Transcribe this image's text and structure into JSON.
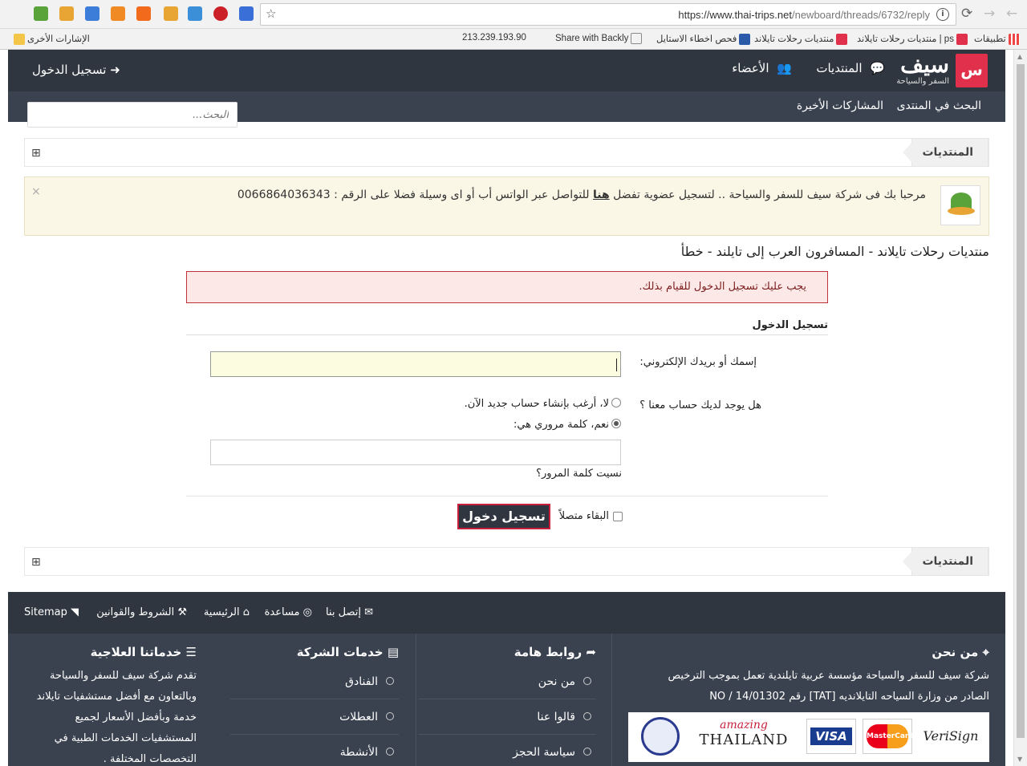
{
  "browser": {
    "url_host": "https://www.thai-trips.net",
    "url_path": "/newboard/threads/6732/reply",
    "bookmarks": [
      {
        "label": "تطبيقات"
      },
      {
        "label": "منتديات رحلات تايلاند | ps"
      },
      {
        "label": "منتديات رحلات تايلاند"
      },
      {
        "label": "فحص اخطاء الاستايل"
      },
      {
        "label": "Share with Backly"
      },
      {
        "label": "213.239.193.90"
      }
    ],
    "other_bookmarks": "الإشارات الأخرى"
  },
  "header": {
    "logo_mark": "سيف",
    "logo_sub": "السفر والسياحة",
    "nav_forums": "المنتديات",
    "nav_members": "الأعضاء",
    "login": "تسجيل الدخول"
  },
  "subnav": {
    "search_forum": "البحث في المنتدى",
    "recent_posts": "المشاركات الأخيرة",
    "search_placeholder": "البحث..."
  },
  "breadcrumb": {
    "label": "المنتديات"
  },
  "notice": {
    "text_before": "مرحبا بك فى شركة سيف للسفر والسياحة .. لتسجيل عضوية تفضل",
    "link": "هنا",
    "text_after": "للتواصل عبر الواتس أب أو اى وسيلة فضلا على الرقم : 0066864036343",
    "close": "×"
  },
  "page_title": "منتديات رحلات تايلاند - المسافرون العرب إلى تايلند - خطأ",
  "error_message": "يجب عليك تسجيل الدخول للقيام بذلك.",
  "login_form": {
    "section_title": "تسجيل الدخول",
    "username_label": "إسمك أو بريدك الإلكتروني:",
    "account_question": "هل يوجد لديك حساب معنا ؟",
    "option_no": "لا، أرغب بإنشاء حساب جديد الآن.",
    "option_yes": "نعم، كلمة مروري هي:",
    "forgot_password": "نسيت كلمة المرور؟",
    "stay_logged_in": "البقاء متصلاً",
    "submit": "تسجيل دخول"
  },
  "footer_links": {
    "contact": "إتصل بنا",
    "help": "مساعدة",
    "home": "الرئيسية",
    "terms": "الشروط والقوانين",
    "sitemap": "Sitemap"
  },
  "footer": {
    "about_title": "من نحن",
    "about_line1": "شركة سيف للسفر والسياحة مؤسسة عربية تايلندية تعمل بموجب الترخيص",
    "about_line2": "الصادر من وزارة السياحه التايلانديه [TAT] رقم NO / 14/01302",
    "links_title": "روابط هامة",
    "links": [
      "من نحن",
      "قالوا عنا",
      "سياسة الحجز"
    ],
    "services_title": "خدمات الشركة",
    "services": [
      "الفنادق",
      "العطلات",
      "الأنشطة"
    ],
    "medical_title": "خدماتنا العلاجية",
    "medical_lines": [
      "تقدم شركة سيف للسفر والسياحة",
      "وبالتعاون مع أفضل مستشفيات تايلاند",
      "خدمة وبأفضل الأسعار لجميع",
      "المستشفيات الخدمات الطبية في",
      "التخصصات المختلفة ."
    ],
    "badge_amazing": "amazing",
    "badge_thailand": "THAILAND",
    "badge_visa": "VISA",
    "badge_mastercard": "MasterCard",
    "badge_verisign": "VeriSign"
  },
  "colors": {
    "header_bg": "#2f3640",
    "subnav_bg": "#3a4250",
    "accent": "#e0304c",
    "notice_bg": "#fbf7e6",
    "error_border": "#c0313a"
  }
}
